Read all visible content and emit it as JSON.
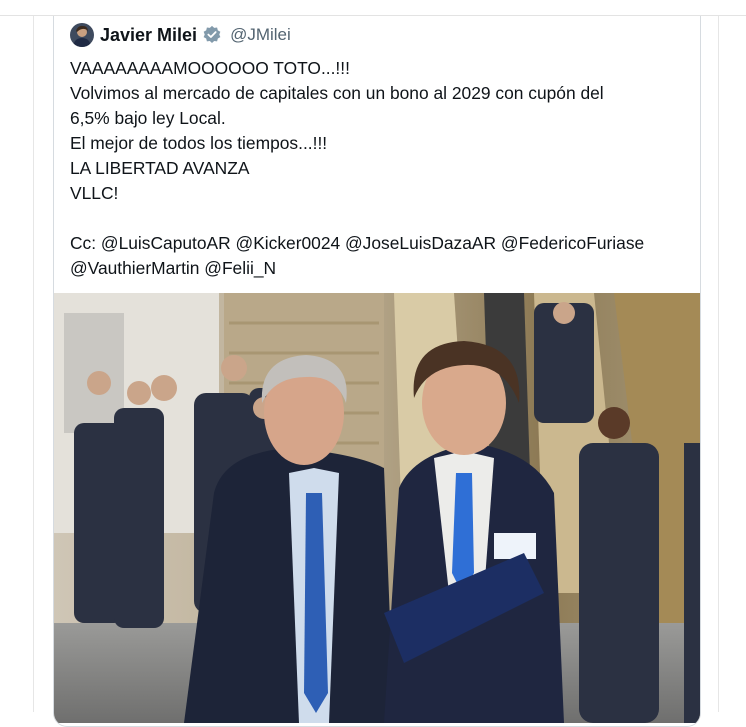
{
  "tweet": {
    "author_name": "Javier Milei",
    "author_handle": "@JMilei",
    "verified_icon": "verified-badge-icon",
    "lines": [
      "VAAAAAAAAMOOOOOO TOTO...!!!",
      "Volvimos al mercado de capitales con un bono al 2029 con cupón del",
      "6,5% bajo ley Local.",
      "El mejor de todos los tiempos...!!!",
      "LA LIBERTAD AVANZA",
      "VLLC!",
      "",
      "Cc: @LuisCaputoAR @Kicker0024 @JoseLuisDazaAR @FedericoFuriase",
      "@VauthierMartin @Felii_N"
    ]
  },
  "colors": {
    "text": "#0f1419",
    "secondary": "#536471",
    "verified": "#829aab",
    "border": "#d6dbe0"
  }
}
